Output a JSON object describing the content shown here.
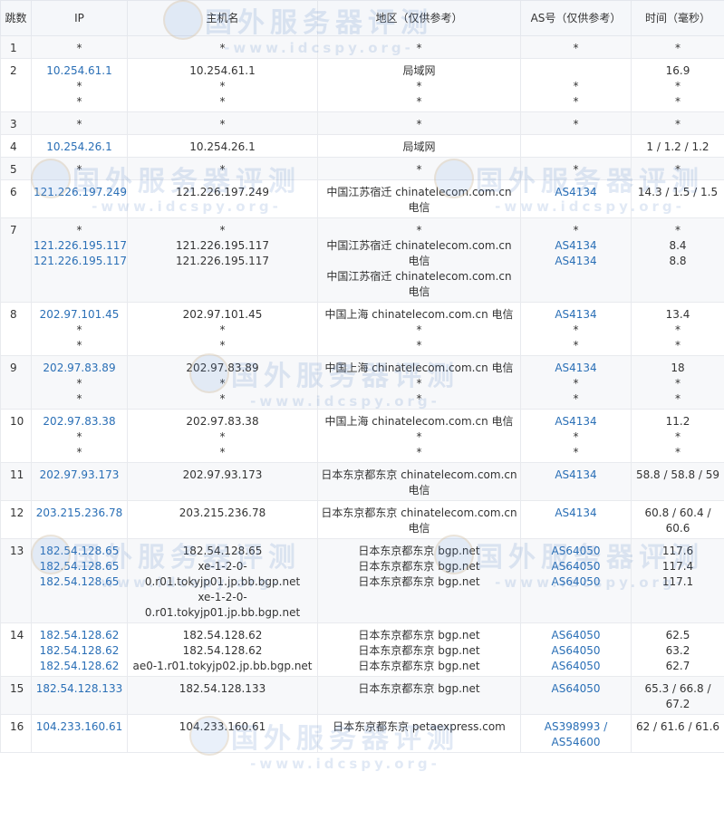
{
  "headers": [
    "跳数",
    "IP",
    "主机名",
    "地区（仅供参考）",
    "AS号（仅供参考）",
    "时间（毫秒）"
  ],
  "watermark": {
    "title": "国外服务器评测",
    "sub": "-www.idcspy.org-"
  },
  "rows": [
    {
      "hop": "1",
      "ips": [
        "*"
      ],
      "hosts": [
        "*"
      ],
      "regions": [
        "*"
      ],
      "as": [
        "*"
      ],
      "times": [
        "*"
      ]
    },
    {
      "hop": "2",
      "ips": [
        "10.254.61.1",
        "*",
        "*"
      ],
      "hosts": [
        "10.254.61.1",
        "*",
        "*"
      ],
      "regions": [
        "局域网",
        "*",
        "*"
      ],
      "as": [
        "",
        "*",
        "*"
      ],
      "times": [
        "16.9",
        "*",
        "*"
      ]
    },
    {
      "hop": "3",
      "ips": [
        "*"
      ],
      "hosts": [
        "*"
      ],
      "regions": [
        "*"
      ],
      "as": [
        "*"
      ],
      "times": [
        "*"
      ]
    },
    {
      "hop": "4",
      "ips": [
        "10.254.26.1"
      ],
      "hosts": [
        "10.254.26.1"
      ],
      "regions": [
        "局域网"
      ],
      "as": [
        ""
      ],
      "times": [
        "1 / 1.2 / 1.2"
      ]
    },
    {
      "hop": "5",
      "ips": [
        "*"
      ],
      "hosts": [
        "*"
      ],
      "regions": [
        "*"
      ],
      "as": [
        "*"
      ],
      "times": [
        "*"
      ]
    },
    {
      "hop": "6",
      "ips": [
        "121.226.197.249"
      ],
      "hosts": [
        "121.226.197.249"
      ],
      "regions": [
        "中国江苏宿迁 chinatelecom.com.cn 电信"
      ],
      "as": [
        "AS4134"
      ],
      "times": [
        "14.3 / 1.5 / 1.5"
      ]
    },
    {
      "hop": "7",
      "ips": [
        "*",
        "121.226.195.117",
        "121.226.195.117"
      ],
      "hosts": [
        "*",
        "121.226.195.117",
        "121.226.195.117"
      ],
      "regions": [
        "*",
        "中国江苏宿迁 chinatelecom.com.cn 电信",
        "中国江苏宿迁 chinatelecom.com.cn 电信"
      ],
      "as": [
        "*",
        "AS4134",
        "AS4134"
      ],
      "times": [
        "*",
        "8.4",
        "8.8"
      ]
    },
    {
      "hop": "8",
      "ips": [
        "202.97.101.45",
        "*",
        "*"
      ],
      "hosts": [
        "202.97.101.45",
        "*",
        "*"
      ],
      "regions": [
        "中国上海 chinatelecom.com.cn 电信",
        "*",
        "*"
      ],
      "as": [
        "AS4134",
        "*",
        "*"
      ],
      "times": [
        "13.4",
        "*",
        "*"
      ]
    },
    {
      "hop": "9",
      "ips": [
        "202.97.83.89",
        "*",
        "*"
      ],
      "hosts": [
        "202.97.83.89",
        "*",
        "*"
      ],
      "regions": [
        "中国上海 chinatelecom.com.cn 电信",
        "*",
        "*"
      ],
      "as": [
        "AS4134",
        "*",
        "*"
      ],
      "times": [
        "18",
        "*",
        "*"
      ]
    },
    {
      "hop": "10",
      "ips": [
        "202.97.83.38",
        "*",
        "*"
      ],
      "hosts": [
        "202.97.83.38",
        "*",
        "*"
      ],
      "regions": [
        "中国上海 chinatelecom.com.cn 电信",
        "*",
        "*"
      ],
      "as": [
        "AS4134",
        "*",
        "*"
      ],
      "times": [
        "11.2",
        "*",
        "*"
      ]
    },
    {
      "hop": "11",
      "ips": [
        "202.97.93.173"
      ],
      "hosts": [
        "202.97.93.173"
      ],
      "regions": [
        "日本东京都东京 chinatelecom.com.cn 电信"
      ],
      "as": [
        "AS4134"
      ],
      "times": [
        "58.8 / 58.8 / 59"
      ]
    },
    {
      "hop": "12",
      "ips": [
        "203.215.236.78"
      ],
      "hosts": [
        "203.215.236.78"
      ],
      "regions": [
        "日本东京都东京 chinatelecom.com.cn 电信"
      ],
      "as": [
        "AS4134"
      ],
      "times": [
        "60.8 / 60.4 / 60.6"
      ]
    },
    {
      "hop": "13",
      "ips": [
        "182.54.128.65",
        "182.54.128.65",
        "182.54.128.65"
      ],
      "hosts": [
        "182.54.128.65",
        "xe-1-2-0-0.r01.tokyjp01.jp.bb.bgp.net",
        "xe-1-2-0-0.r01.tokyjp01.jp.bb.bgp.net"
      ],
      "regions": [
        "日本东京都东京 bgp.net",
        "日本东京都东京 bgp.net",
        "日本东京都东京 bgp.net"
      ],
      "as": [
        "AS64050",
        "AS64050",
        "AS64050"
      ],
      "times": [
        "117.6",
        "117.4",
        "117.1"
      ]
    },
    {
      "hop": "14",
      "ips": [
        "182.54.128.62",
        "182.54.128.62",
        "182.54.128.62"
      ],
      "hosts": [
        "182.54.128.62",
        "182.54.128.62",
        "ae0-1.r01.tokyjp02.jp.bb.bgp.net"
      ],
      "regions": [
        "日本东京都东京 bgp.net",
        "日本东京都东京 bgp.net",
        "日本东京都东京 bgp.net"
      ],
      "as": [
        "AS64050",
        "AS64050",
        "AS64050"
      ],
      "times": [
        "62.5",
        "63.2",
        "62.7"
      ]
    },
    {
      "hop": "15",
      "ips": [
        "182.54.128.133"
      ],
      "hosts": [
        "182.54.128.133"
      ],
      "regions": [
        "日本东京都东京 bgp.net"
      ],
      "as": [
        "AS64050"
      ],
      "times": [
        "65.3 / 66.8 / 67.2"
      ]
    },
    {
      "hop": "16",
      "ips": [
        "104.233.160.61"
      ],
      "hosts": [
        "104.233.160.61"
      ],
      "regions": [
        "日本东京都东京 petaexpress.com"
      ],
      "as": [
        "AS398993 / AS54600"
      ],
      "times": [
        "62 / 61.6 / 61.6"
      ]
    }
  ]
}
